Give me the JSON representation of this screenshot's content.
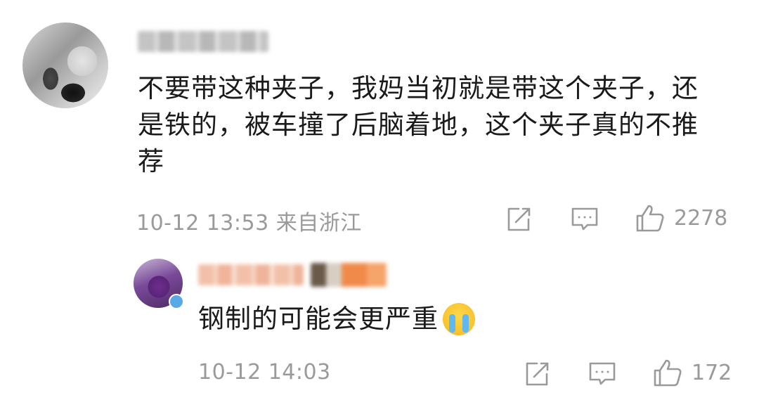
{
  "comment": {
    "text": "不要带这种夹子，我妈当初就是带这个夹子，还是铁的，被车撞了后脑着地，这个夹子真的不推荐",
    "timestamp": "10-12 13:53",
    "location": "来自浙江",
    "likes": "2278"
  },
  "reply": {
    "text": "钢制的可能会更严重",
    "emoji": "loudly-crying-face",
    "timestamp": "10-12 14:03",
    "likes": "172"
  },
  "colors": {
    "text": "#1a1a1a",
    "meta": "#9a9a9a",
    "background": "#ffffff"
  }
}
